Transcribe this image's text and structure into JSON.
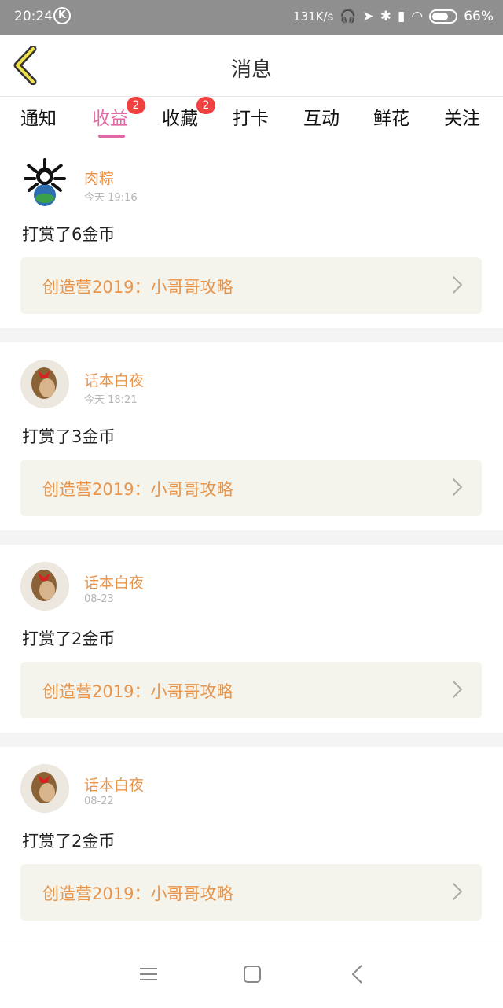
{
  "status_bar": {
    "time": "20:24",
    "k_icon": "K",
    "speed": "131K/s",
    "battery": "66%",
    "icons": [
      "headphones-icon",
      "location-icon",
      "bluetooth-icon",
      "signal-icon",
      "wifi-icon",
      "battery-icon"
    ]
  },
  "header": {
    "title": "消息",
    "back_icon": "chevron-left-icon"
  },
  "tabs": [
    {
      "label": "通知",
      "active": false,
      "badge": ""
    },
    {
      "label": "收益",
      "active": true,
      "badge": "2"
    },
    {
      "label": "收藏",
      "active": false,
      "badge": "2"
    },
    {
      "label": "打卡",
      "active": false,
      "badge": ""
    },
    {
      "label": "互动",
      "active": false,
      "badge": ""
    },
    {
      "label": "鲜花",
      "active": false,
      "badge": ""
    },
    {
      "label": "关注",
      "active": false,
      "badge": ""
    }
  ],
  "messages": [
    {
      "user": "肉粽",
      "time": "今天 19:16",
      "text": "打赏了6金币",
      "link": "创造营2019：小哥哥攻略"
    },
    {
      "user": "话本白夜",
      "time": "今天 18:21",
      "text": "打赏了3金币",
      "link": "创造营2019：小哥哥攻略"
    },
    {
      "user": "话本白夜",
      "time": "08-23",
      "text": "打赏了2金币",
      "link": "创造营2019：小哥哥攻略"
    },
    {
      "user": "话本白夜",
      "time": "08-22",
      "text": "打赏了2金币",
      "link": "创造营2019：小哥哥攻略"
    }
  ],
  "nav": [
    "menu-icon",
    "home-square-icon",
    "back-icon"
  ],
  "colors": {
    "accent": "#e06aa3",
    "name": "#e8944a",
    "badge": "#f04040",
    "card_bg": "#f4f4ec"
  }
}
